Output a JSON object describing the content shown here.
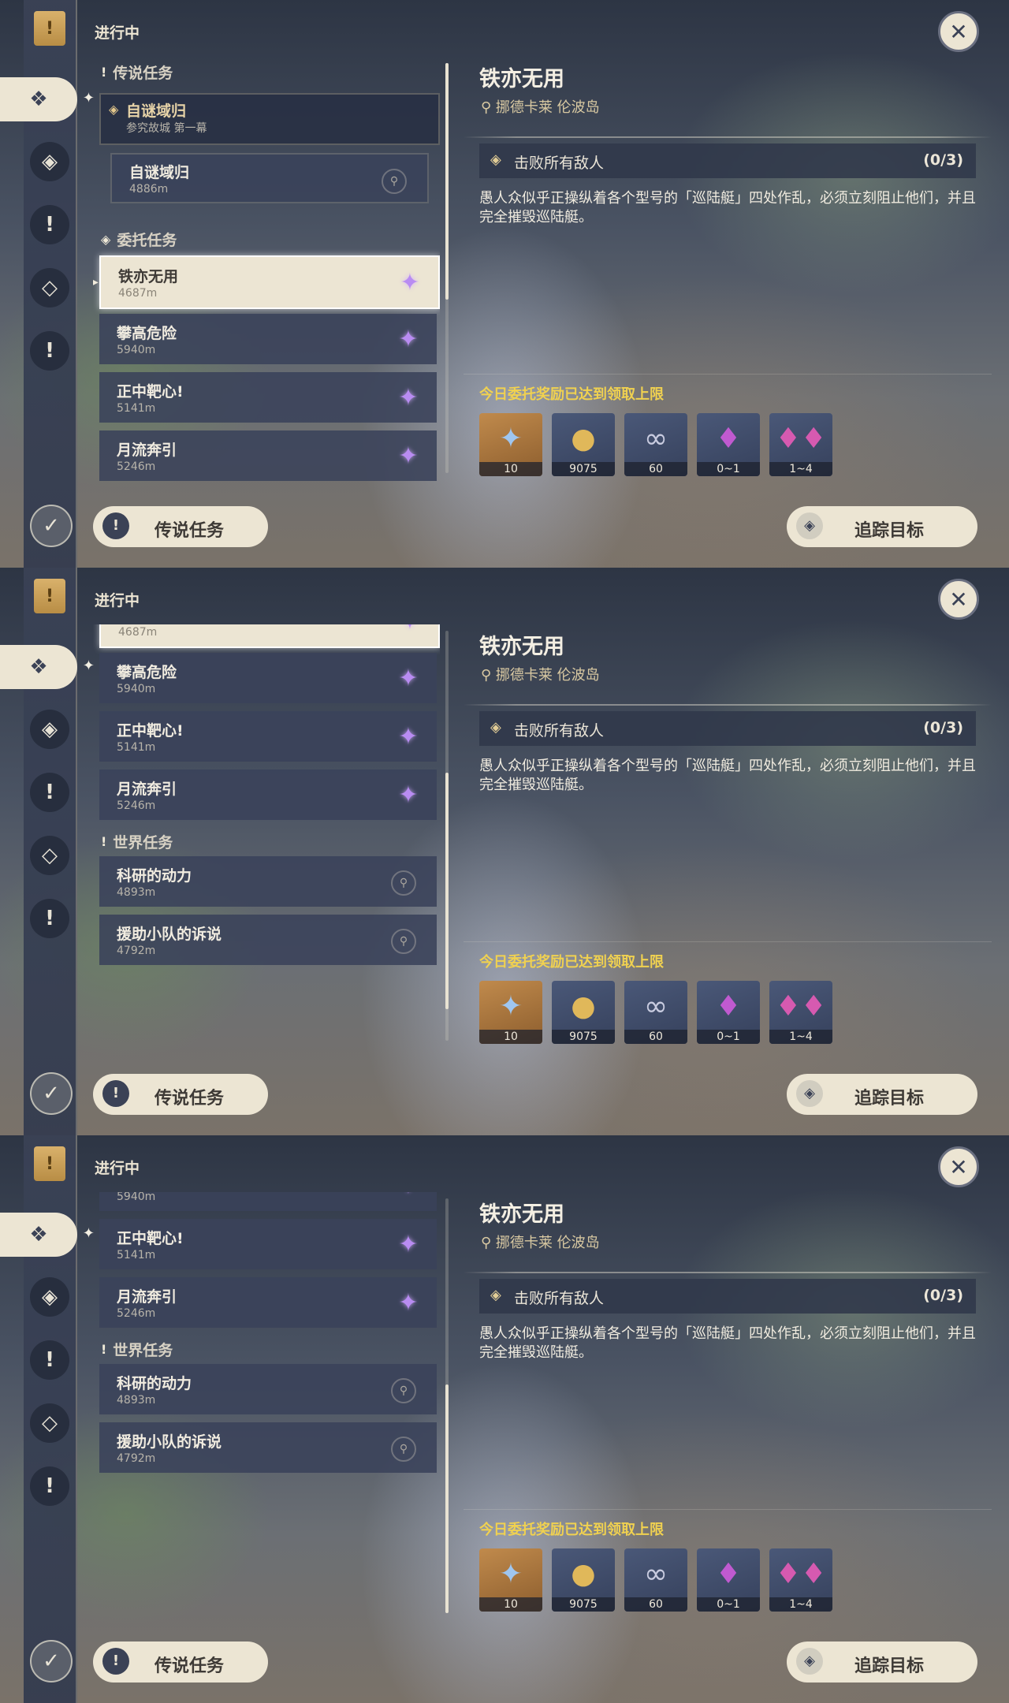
{
  "header": {
    "in_progress": "进行中"
  },
  "sections": {
    "legend": "传说任务",
    "commission": "委托任务",
    "world": "世界任务"
  },
  "legend_quest": {
    "title": "自谜域归",
    "subtitle": "参究故城 第一幕"
  },
  "legend_sub": {
    "title": "自谜域归",
    "distance": "4886m"
  },
  "quests": {
    "q1": {
      "title": "铁亦无用",
      "distance": "4687m"
    },
    "q2": {
      "title": "攀高危险",
      "distance": "5940m"
    },
    "q3": {
      "title": "正中靶心!",
      "distance": "5141m"
    },
    "q4": {
      "title": "月流奔引",
      "distance": "5246m"
    },
    "w1": {
      "title": "科研的动力",
      "distance": "4893m"
    },
    "w2": {
      "title": "援助小队的诉说",
      "distance": "4792m"
    }
  },
  "detail": {
    "title": "铁亦无用",
    "location": "挪德卡莱 伦波岛",
    "objective": "击败所有敌人",
    "objective_count": "(0/3)",
    "description": "愚人众似乎正操纵着各个型号的「巡陆艇」四处作乱，必须立刻阻止他们，并且完全摧毁巡陆艇。",
    "reward_note": "今日委托奖励已达到领取上限"
  },
  "rewards": [
    {
      "icon": "primogem-icon",
      "qty": "10"
    },
    {
      "icon": "mora-icon",
      "qty": "9075"
    },
    {
      "icon": "exp-icon",
      "qty": "60"
    },
    {
      "icon": "crystal-icon",
      "qty": "0~1"
    },
    {
      "icon": "crystal-cluster-icon",
      "qty": "1~4"
    }
  ],
  "buttons": {
    "legend": "传说任务",
    "track": "追踪目标"
  },
  "colors": {
    "panel": "#3a425a",
    "cream": "#ece5d3",
    "gold_note": "#f0d150",
    "star_purple": "#b98cf2"
  }
}
